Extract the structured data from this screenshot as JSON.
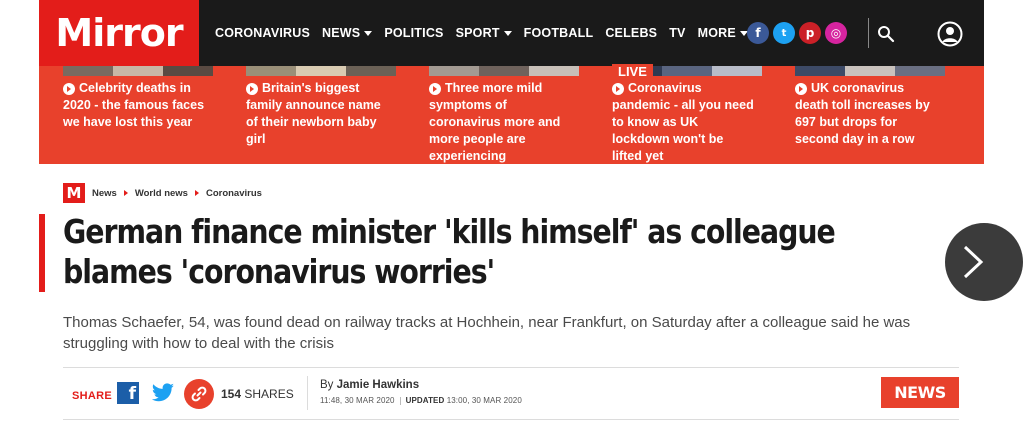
{
  "brand": {
    "logo": "Mirror",
    "accent": "#e31d1a",
    "strip": "#e8412c"
  },
  "nav": {
    "items": [
      {
        "label": "CORONAVIRUS",
        "dropdown": false
      },
      {
        "label": "NEWS",
        "dropdown": true
      },
      {
        "label": "POLITICS",
        "dropdown": false
      },
      {
        "label": "SPORT",
        "dropdown": true
      },
      {
        "label": "FOOTBALL",
        "dropdown": false
      },
      {
        "label": "CELEBS",
        "dropdown": false
      },
      {
        "label": "TV",
        "dropdown": false
      },
      {
        "label": "MORE",
        "dropdown": true
      }
    ],
    "social": [
      {
        "name": "facebook-icon",
        "glyph": "f"
      },
      {
        "name": "twitter-icon",
        "glyph": "t"
      },
      {
        "name": "pinterest-icon",
        "glyph": "p"
      },
      {
        "name": "instagram-icon",
        "glyph": "◎"
      }
    ]
  },
  "strip": {
    "stories": [
      {
        "text": "Celebrity deaths in 2020 - the famous faces we have lost this year",
        "live": ""
      },
      {
        "text": "Britain's biggest family announce name of their newborn baby girl",
        "live": ""
      },
      {
        "text": "Three more mild symptoms of coronavirus more and more people are experiencing",
        "live": ""
      },
      {
        "text": "Coronavirus pandemic - all you need to know as UK lockdown won't be lifted yet",
        "live": "LIVE"
      },
      {
        "text": "UK coronavirus death toll increases by 697 but drops for second day in a row",
        "live": ""
      }
    ]
  },
  "breadcrumb": {
    "badge": "M",
    "items": [
      "News",
      "World news",
      "Coronavirus"
    ]
  },
  "article": {
    "headline": "German finance minister 'kills himself' as colleague blames 'coronavirus worries'",
    "standfirst": "Thomas Schaefer, 54, was found dead on railway tracks at Hochhein, near Frankfurt, on Saturday after a colleague said he was struggling with how to deal with the crisis",
    "share_label": "SHARE",
    "share_count": "154",
    "share_suffix": " SHARES",
    "by_prefix": "By ",
    "author": "Jamie Hawkins",
    "published": "11:48, 30 MAR 2020",
    "updated_label": "UPDATED",
    "updated": " 13:00, 30 MAR 2020",
    "section_badge": "NEWS"
  }
}
